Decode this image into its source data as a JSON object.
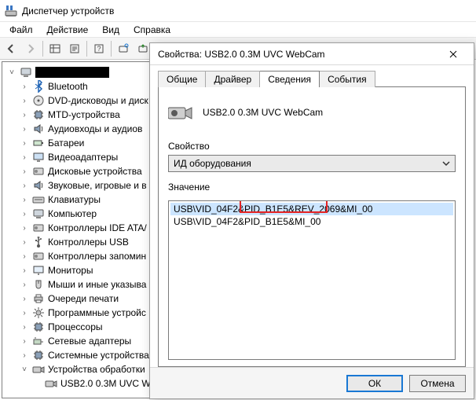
{
  "title": "Диспетчер устройств",
  "menu": {
    "file": "Файл",
    "action": "Действие",
    "view": "Вид",
    "help": "Справка"
  },
  "tree": {
    "items": [
      "Bluetooth",
      "DVD-дисководы и диск",
      "MTD-устройства",
      "Аудиовходы и аудиов",
      "Батареи",
      "Видеоадаптеры",
      "Дисковые устройства",
      "Звуковые, игровые и в",
      "Клавиатуры",
      "Компьютер",
      "Контроллеры IDE ATA/",
      "Контроллеры USB",
      "Контроллеры запомин",
      "Мониторы",
      "Мыши и иные указыва",
      "Очереди печати",
      "Программные устройс",
      "Процессоры",
      "Сетевые адаптеры",
      "Системные устройства"
    ],
    "expanded_label": "Устройства обработки",
    "expanded_child": "USB2.0 0.3M UVC W"
  },
  "dialog": {
    "caption_prefix": "Свойства:",
    "device_name": "USB2.0 0.3M UVC WebCam",
    "tabs": {
      "general": "Общие",
      "driver": "Драйвер",
      "details": "Сведения",
      "events": "События"
    },
    "property_label": "Свойство",
    "property_value": "ИД оборудования",
    "value_label": "Значение",
    "values": [
      "USB\\VID_04F2&PID_B1E5&REV_2069&MI_00",
      "USB\\VID_04F2&PID_B1E5&MI_00"
    ],
    "ok": "ОК",
    "cancel": "Отмена"
  }
}
